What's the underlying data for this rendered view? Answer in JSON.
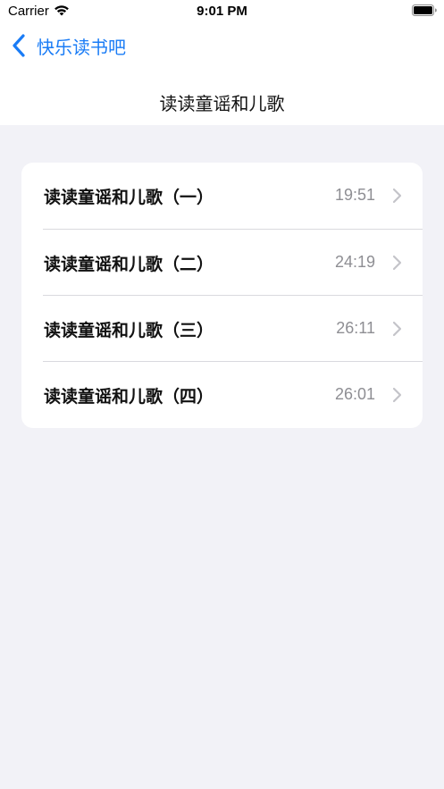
{
  "status_bar": {
    "carrier": "Carrier",
    "time": "9:01 PM"
  },
  "nav": {
    "back_label": "快乐读书吧",
    "title": "读读童谣和儿歌"
  },
  "colors": {
    "accent": "#1a7cf6",
    "background": "#f2f2f7",
    "secondary_text": "#8e8e93"
  },
  "items": [
    {
      "title": "读读童谣和儿歌（一）",
      "duration": "19:51"
    },
    {
      "title": "读读童谣和儿歌（二）",
      "duration": "24:19"
    },
    {
      "title": "读读童谣和儿歌（三）",
      "duration": "26:11"
    },
    {
      "title": "读读童谣和儿歌（四）",
      "duration": "26:01"
    }
  ]
}
